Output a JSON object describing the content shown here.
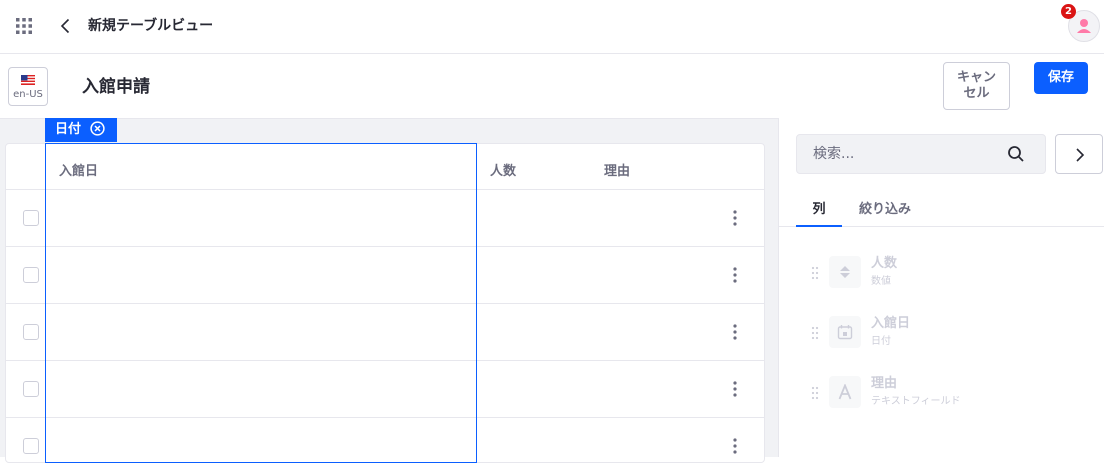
{
  "app": {
    "title": "新規テーブルビュー",
    "notification_count": "2"
  },
  "header": {
    "locale": "en-US",
    "page_title": "入館申請",
    "cancel_label": "キャン\nセル",
    "save_label": "保存"
  },
  "table": {
    "columns": [
      "入館日",
      "人数",
      "理由"
    ],
    "selected_column_tag": "日付",
    "row_count": 5
  },
  "panel": {
    "search_placeholder": "検索...",
    "tabs": [
      "列",
      "絞り込み"
    ],
    "active_tab": "列",
    "fields": [
      {
        "name": "人数",
        "type": "数値",
        "icon": "number-icon"
      },
      {
        "name": "入館日",
        "type": "日付",
        "icon": "calendar-icon"
      },
      {
        "name": "理由",
        "type": "テキストフィールド",
        "icon": "text-icon"
      }
    ]
  },
  "colors": {
    "accent": "#0b5fff",
    "badge": "#da1414",
    "avatar": "#ff7aa8"
  }
}
